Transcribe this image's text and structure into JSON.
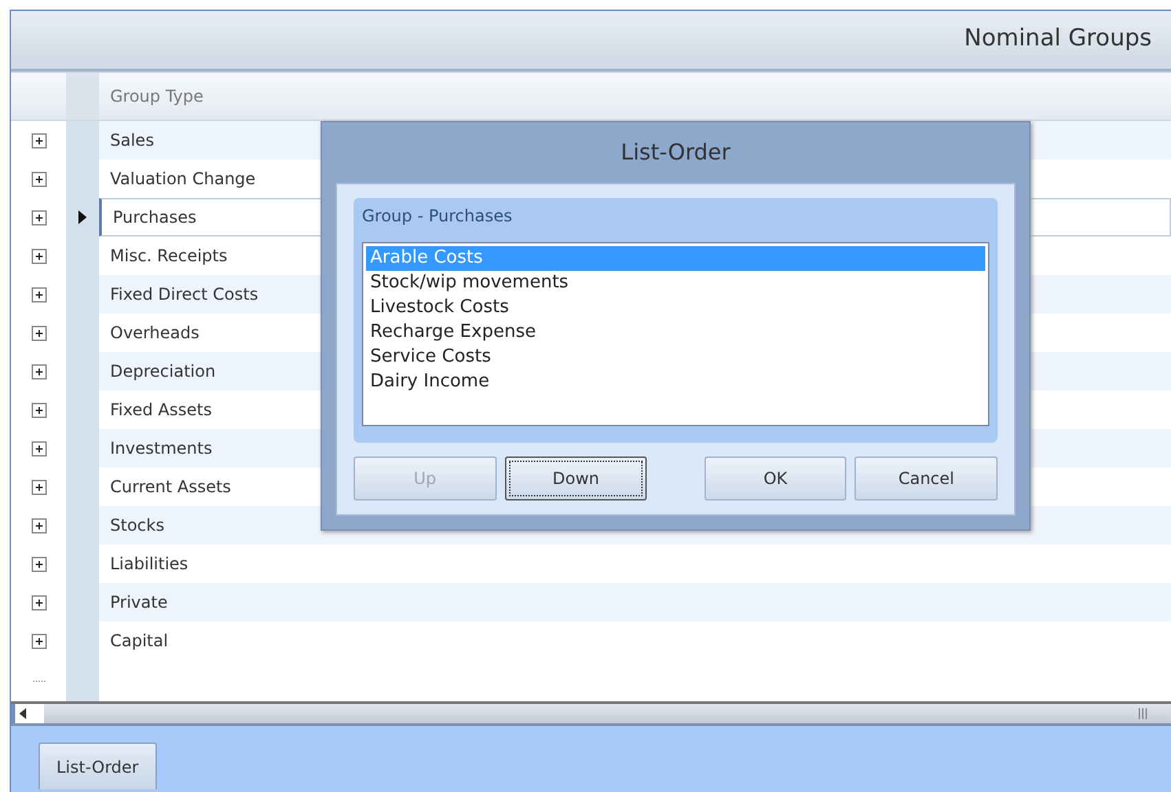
{
  "window": {
    "title": "Nominal Groups"
  },
  "grid": {
    "columns": [
      "Group Type"
    ],
    "rows": [
      {
        "label": "Sales",
        "current": false,
        "expanded": false
      },
      {
        "label": "Valuation Change",
        "current": false,
        "expanded": false
      },
      {
        "label": "Purchases",
        "current": true,
        "expanded": false
      },
      {
        "label": "Misc. Receipts",
        "current": false,
        "expanded": false
      },
      {
        "label": "Fixed Direct Costs",
        "current": false,
        "expanded": false
      },
      {
        "label": "Overheads",
        "current": false,
        "expanded": false
      },
      {
        "label": "Depreciation",
        "current": false,
        "expanded": false
      },
      {
        "label": "Fixed Assets",
        "current": false,
        "expanded": false
      },
      {
        "label": "Investments",
        "current": false,
        "expanded": false
      },
      {
        "label": "Current Assets",
        "current": false,
        "expanded": false
      },
      {
        "label": "Stocks",
        "current": false,
        "expanded": false
      },
      {
        "label": "Liabilities",
        "current": false,
        "expanded": false
      },
      {
        "label": "Private",
        "current": false,
        "expanded": false
      },
      {
        "label": "Capital",
        "current": false,
        "expanded": false
      }
    ]
  },
  "dialog": {
    "title": "List-Order",
    "group_label": "Group - Purchases",
    "items": [
      {
        "label": "Arable Costs",
        "selected": true
      },
      {
        "label": "Stock/wip movements",
        "selected": false
      },
      {
        "label": "Livestock Costs",
        "selected": false
      },
      {
        "label": "Recharge Expense",
        "selected": false
      },
      {
        "label": "Service Costs",
        "selected": false
      },
      {
        "label": "Dairy Income",
        "selected": false
      }
    ],
    "buttons": [
      {
        "label": "Up",
        "disabled": true,
        "focused": false
      },
      {
        "label": "Down",
        "disabled": false,
        "focused": true
      },
      {
        "label": "OK",
        "disabled": false,
        "focused": false
      },
      {
        "label": "Cancel",
        "disabled": false,
        "focused": false
      }
    ]
  },
  "footer": {
    "tabs": [
      {
        "label": "List-Order"
      }
    ]
  }
}
